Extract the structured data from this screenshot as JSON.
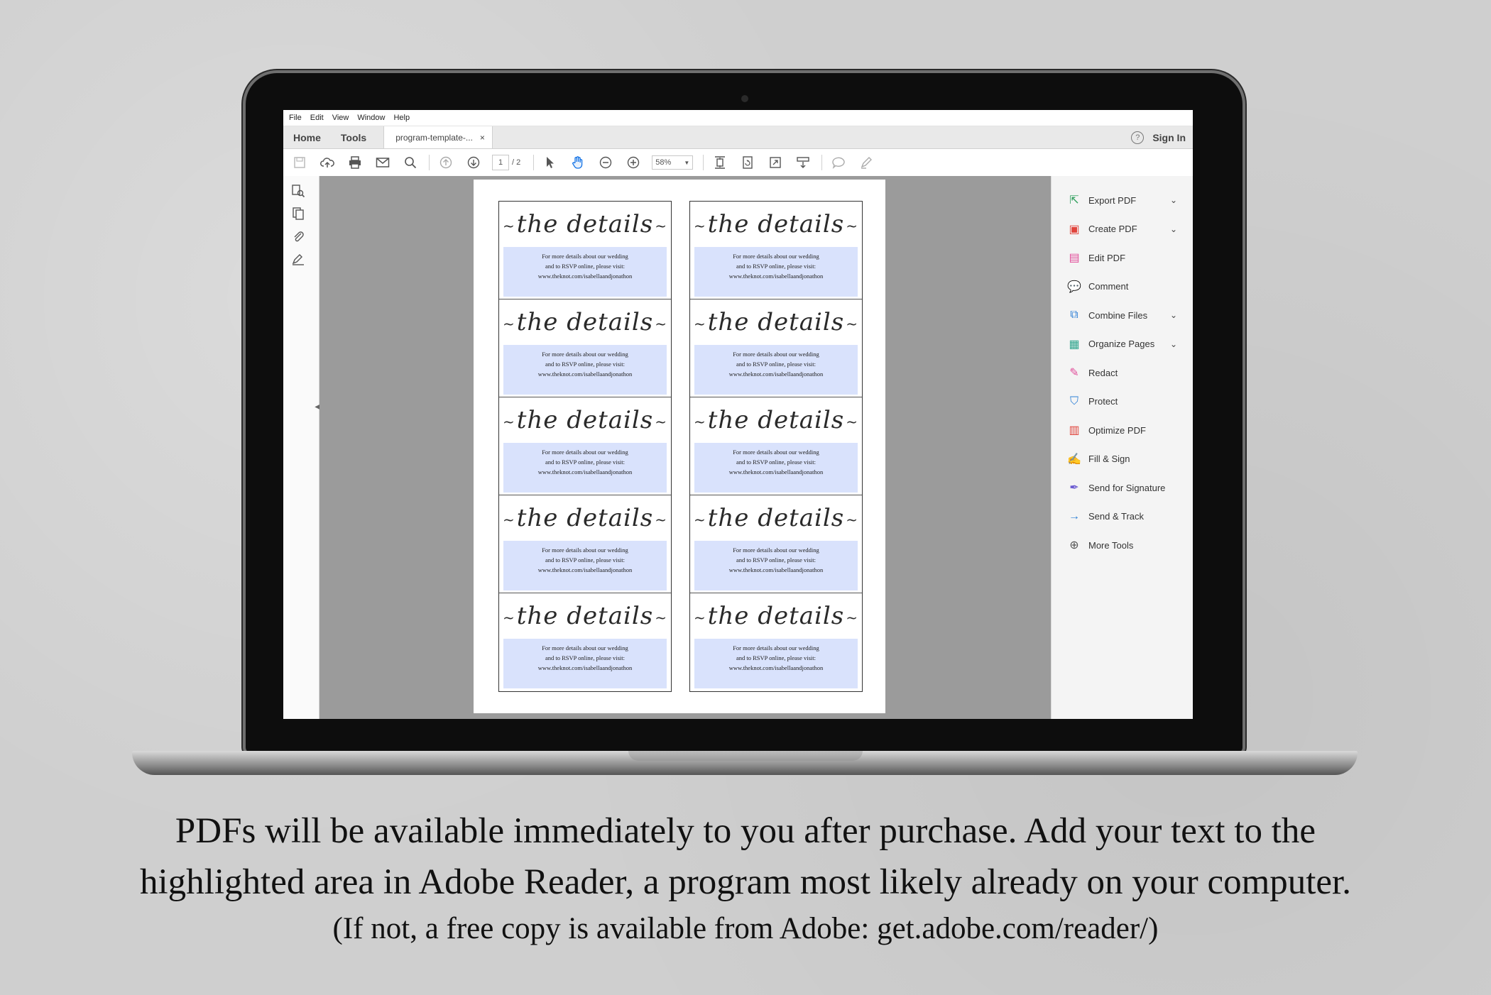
{
  "menubar": [
    "File",
    "Edit",
    "View",
    "Window",
    "Help"
  ],
  "tabs": {
    "home": "Home",
    "tools": "Tools",
    "document": "program-template-...",
    "close": "×",
    "help": "?",
    "sign_in": "Sign In"
  },
  "toolbar": {
    "current_page": "1",
    "total_pages": "/ 2",
    "zoom": "58%"
  },
  "document": {
    "card_title": "the details",
    "card_line1": "For more details about our wedding",
    "card_line2": "and to RSVP online, please visit:",
    "card_url": "www.theknot.com/isabellaandjonathon"
  },
  "tools_pane": [
    {
      "label": "Export PDF",
      "icon": "export-pdf-icon",
      "color": "#2e9e5b",
      "chevron": true
    },
    {
      "label": "Create PDF",
      "icon": "create-pdf-icon",
      "color": "#e0443c",
      "chevron": true
    },
    {
      "label": "Edit PDF",
      "icon": "edit-pdf-icon",
      "color": "#e14d9a",
      "chevron": false
    },
    {
      "label": "Comment",
      "icon": "comment-icon",
      "color": "#f2b520",
      "chevron": false
    },
    {
      "label": "Combine Files",
      "icon": "combine-files-icon",
      "color": "#2d7fd6",
      "chevron": true
    },
    {
      "label": "Organize Pages",
      "icon": "organize-pages-icon",
      "color": "#2fa58d",
      "chevron": true
    },
    {
      "label": "Redact",
      "icon": "redact-icon",
      "color": "#e14d9a",
      "chevron": false
    },
    {
      "label": "Protect",
      "icon": "protect-icon",
      "color": "#2d7fd6",
      "chevron": false
    },
    {
      "label": "Optimize PDF",
      "icon": "optimize-pdf-icon",
      "color": "#e0443c",
      "chevron": false
    },
    {
      "label": "Fill & Sign",
      "icon": "fill-sign-icon",
      "color": "#6b5bd1",
      "chevron": false
    },
    {
      "label": "Send for Signature",
      "icon": "send-for-signature-icon",
      "color": "#6b5bd1",
      "chevron": false
    },
    {
      "label": "Send & Track",
      "icon": "send-track-icon",
      "color": "#2d7fd6",
      "chevron": false
    },
    {
      "label": "More Tools",
      "icon": "more-tools-icon",
      "color": "#555555",
      "chevron": false
    }
  ],
  "caption": {
    "line1": "PDFs will be available immediately to you after purchase.  Add your text to the",
    "line2": "highlighted area in Adobe Reader, a program most likely already on your computer.",
    "line3": "(If not, a free copy is available from Adobe: get.adobe.com/reader/)"
  }
}
